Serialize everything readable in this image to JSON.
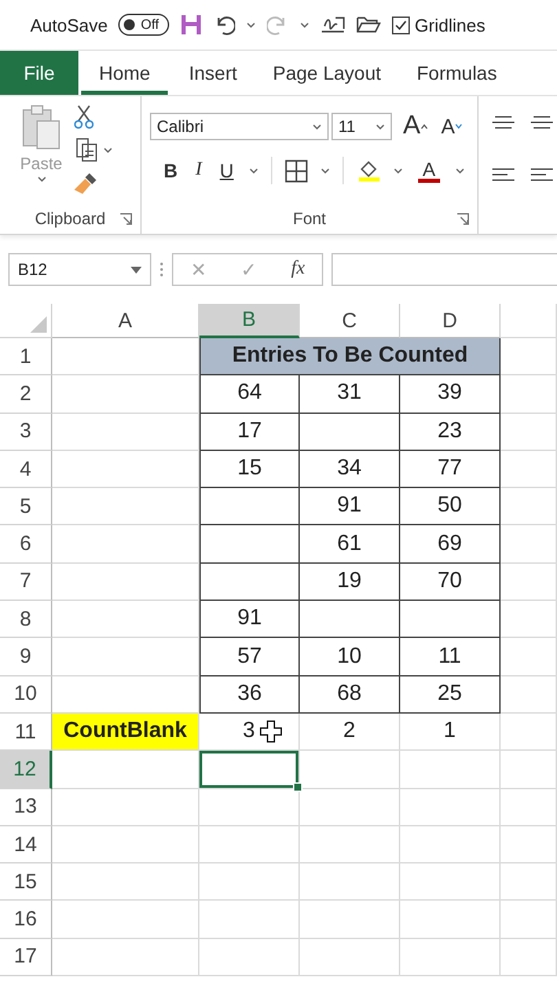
{
  "quick_access": {
    "autosave": {
      "label": "AutoSave",
      "state_text": "Off",
      "on": false
    },
    "gridlines": {
      "label": "Gridlines",
      "checked": true
    }
  },
  "tabs": [
    {
      "label": "File",
      "kind": "file",
      "selected": false
    },
    {
      "label": "Home",
      "kind": "tab",
      "selected": true
    },
    {
      "label": "Insert",
      "kind": "tab",
      "selected": false
    },
    {
      "label": "Page Layout",
      "kind": "tab",
      "selected": false
    },
    {
      "label": "Formulas",
      "kind": "tab",
      "selected": false
    }
  ],
  "ribbon": {
    "clipboard": {
      "label": "Clipboard",
      "paste": {
        "label": "Paste",
        "disabled": true
      }
    },
    "font": {
      "label": "Font",
      "name": "Calibri",
      "size": "11",
      "grow": "A",
      "shrink": "A",
      "bold": "B",
      "italic": "I",
      "underline": "U",
      "font_color": "A"
    }
  },
  "formula_bar": {
    "name_box": "B12",
    "cancel": "✕",
    "enter": "✓",
    "function": "fx"
  },
  "sheet": {
    "columns": [
      {
        "label": "A",
        "selected": false
      },
      {
        "label": "B",
        "selected": true
      },
      {
        "label": "C",
        "selected": false
      },
      {
        "label": "D",
        "selected": false
      }
    ],
    "rows": [
      {
        "number": "1",
        "selected": false,
        "cells": [
          {
            "kind": "plain",
            "selected": false
          },
          {
            "kind": "title",
            "text": "Entries To Be Counted",
            "selected": false
          }
        ]
      },
      {
        "number": "2",
        "selected": false,
        "cells": [
          {
            "kind": "plain",
            "selected": false
          },
          {
            "kind": "boxed",
            "text": "64",
            "selected": false
          },
          {
            "kind": "boxed",
            "text": "31",
            "selected": false
          },
          {
            "kind": "boxed",
            "text": "39",
            "selected": false
          }
        ]
      },
      {
        "number": "3",
        "selected": false,
        "cells": [
          {
            "kind": "plain",
            "selected": false
          },
          {
            "kind": "boxed",
            "text": "17",
            "selected": false
          },
          {
            "kind": "boxed",
            "selected": false
          },
          {
            "kind": "boxed",
            "text": "23",
            "selected": false
          }
        ]
      },
      {
        "number": "4",
        "selected": false,
        "cells": [
          {
            "kind": "plain",
            "selected": false
          },
          {
            "kind": "boxed",
            "text": "15",
            "selected": false
          },
          {
            "kind": "boxed",
            "text": "34",
            "selected": false
          },
          {
            "kind": "boxed",
            "text": "77",
            "selected": false
          }
        ]
      },
      {
        "number": "5",
        "selected": false,
        "cells": [
          {
            "kind": "plain",
            "selected": false
          },
          {
            "kind": "boxed",
            "selected": false
          },
          {
            "kind": "boxed",
            "text": "91",
            "selected": false
          },
          {
            "kind": "boxed",
            "text": "50",
            "selected": false
          }
        ]
      },
      {
        "number": "6",
        "selected": false,
        "cells": [
          {
            "kind": "plain",
            "selected": false
          },
          {
            "kind": "boxed",
            "selected": false
          },
          {
            "kind": "boxed",
            "text": "61",
            "selected": false
          },
          {
            "kind": "boxed",
            "text": "69",
            "selected": false
          }
        ]
      },
      {
        "number": "7",
        "selected": false,
        "cells": [
          {
            "kind": "plain",
            "selected": false
          },
          {
            "kind": "boxed",
            "selected": false
          },
          {
            "kind": "boxed",
            "text": "19",
            "selected": false
          },
          {
            "kind": "boxed",
            "text": "70",
            "selected": false
          }
        ]
      },
      {
        "number": "8",
        "selected": false,
        "cells": [
          {
            "kind": "plain",
            "selected": false
          },
          {
            "kind": "boxed",
            "text": "91",
            "selected": false
          },
          {
            "kind": "boxed",
            "selected": false
          },
          {
            "kind": "boxed",
            "selected": false
          }
        ]
      },
      {
        "number": "9",
        "selected": false,
        "cells": [
          {
            "kind": "plain",
            "selected": false
          },
          {
            "kind": "boxed",
            "text": "57",
            "selected": false
          },
          {
            "kind": "boxed",
            "text": "10",
            "selected": false
          },
          {
            "kind": "boxed",
            "text": "11",
            "selected": false
          }
        ]
      },
      {
        "number": "10",
        "selected": false,
        "cells": [
          {
            "kind": "plain",
            "selected": false
          },
          {
            "kind": "boxed",
            "text": "36",
            "selected": false
          },
          {
            "kind": "boxed",
            "text": "68",
            "selected": false
          },
          {
            "kind": "boxed",
            "text": "25",
            "selected": false
          }
        ]
      },
      {
        "number": "11",
        "selected": false,
        "cells": [
          {
            "kind": "label",
            "text": "CountBlank",
            "selected": false
          },
          {
            "kind": "plain",
            "text": "3",
            "selected": false,
            "cursor": true
          },
          {
            "kind": "plain",
            "text": "2",
            "selected": false
          },
          {
            "kind": "plain",
            "text": "1",
            "selected": false
          }
        ]
      },
      {
        "number": "12",
        "selected": true,
        "cells": [
          {
            "kind": "plain",
            "selected": false
          },
          {
            "kind": "plain",
            "selected": true
          },
          {
            "kind": "plain",
            "selected": false
          },
          {
            "kind": "plain",
            "selected": false
          }
        ]
      },
      {
        "number": "13",
        "selected": false,
        "cells": []
      },
      {
        "number": "14",
        "selected": false,
        "cells": []
      },
      {
        "number": "15",
        "selected": false,
        "cells": []
      },
      {
        "number": "16",
        "selected": false,
        "cells": []
      },
      {
        "number": "17",
        "selected": false,
        "cells": []
      }
    ]
  }
}
